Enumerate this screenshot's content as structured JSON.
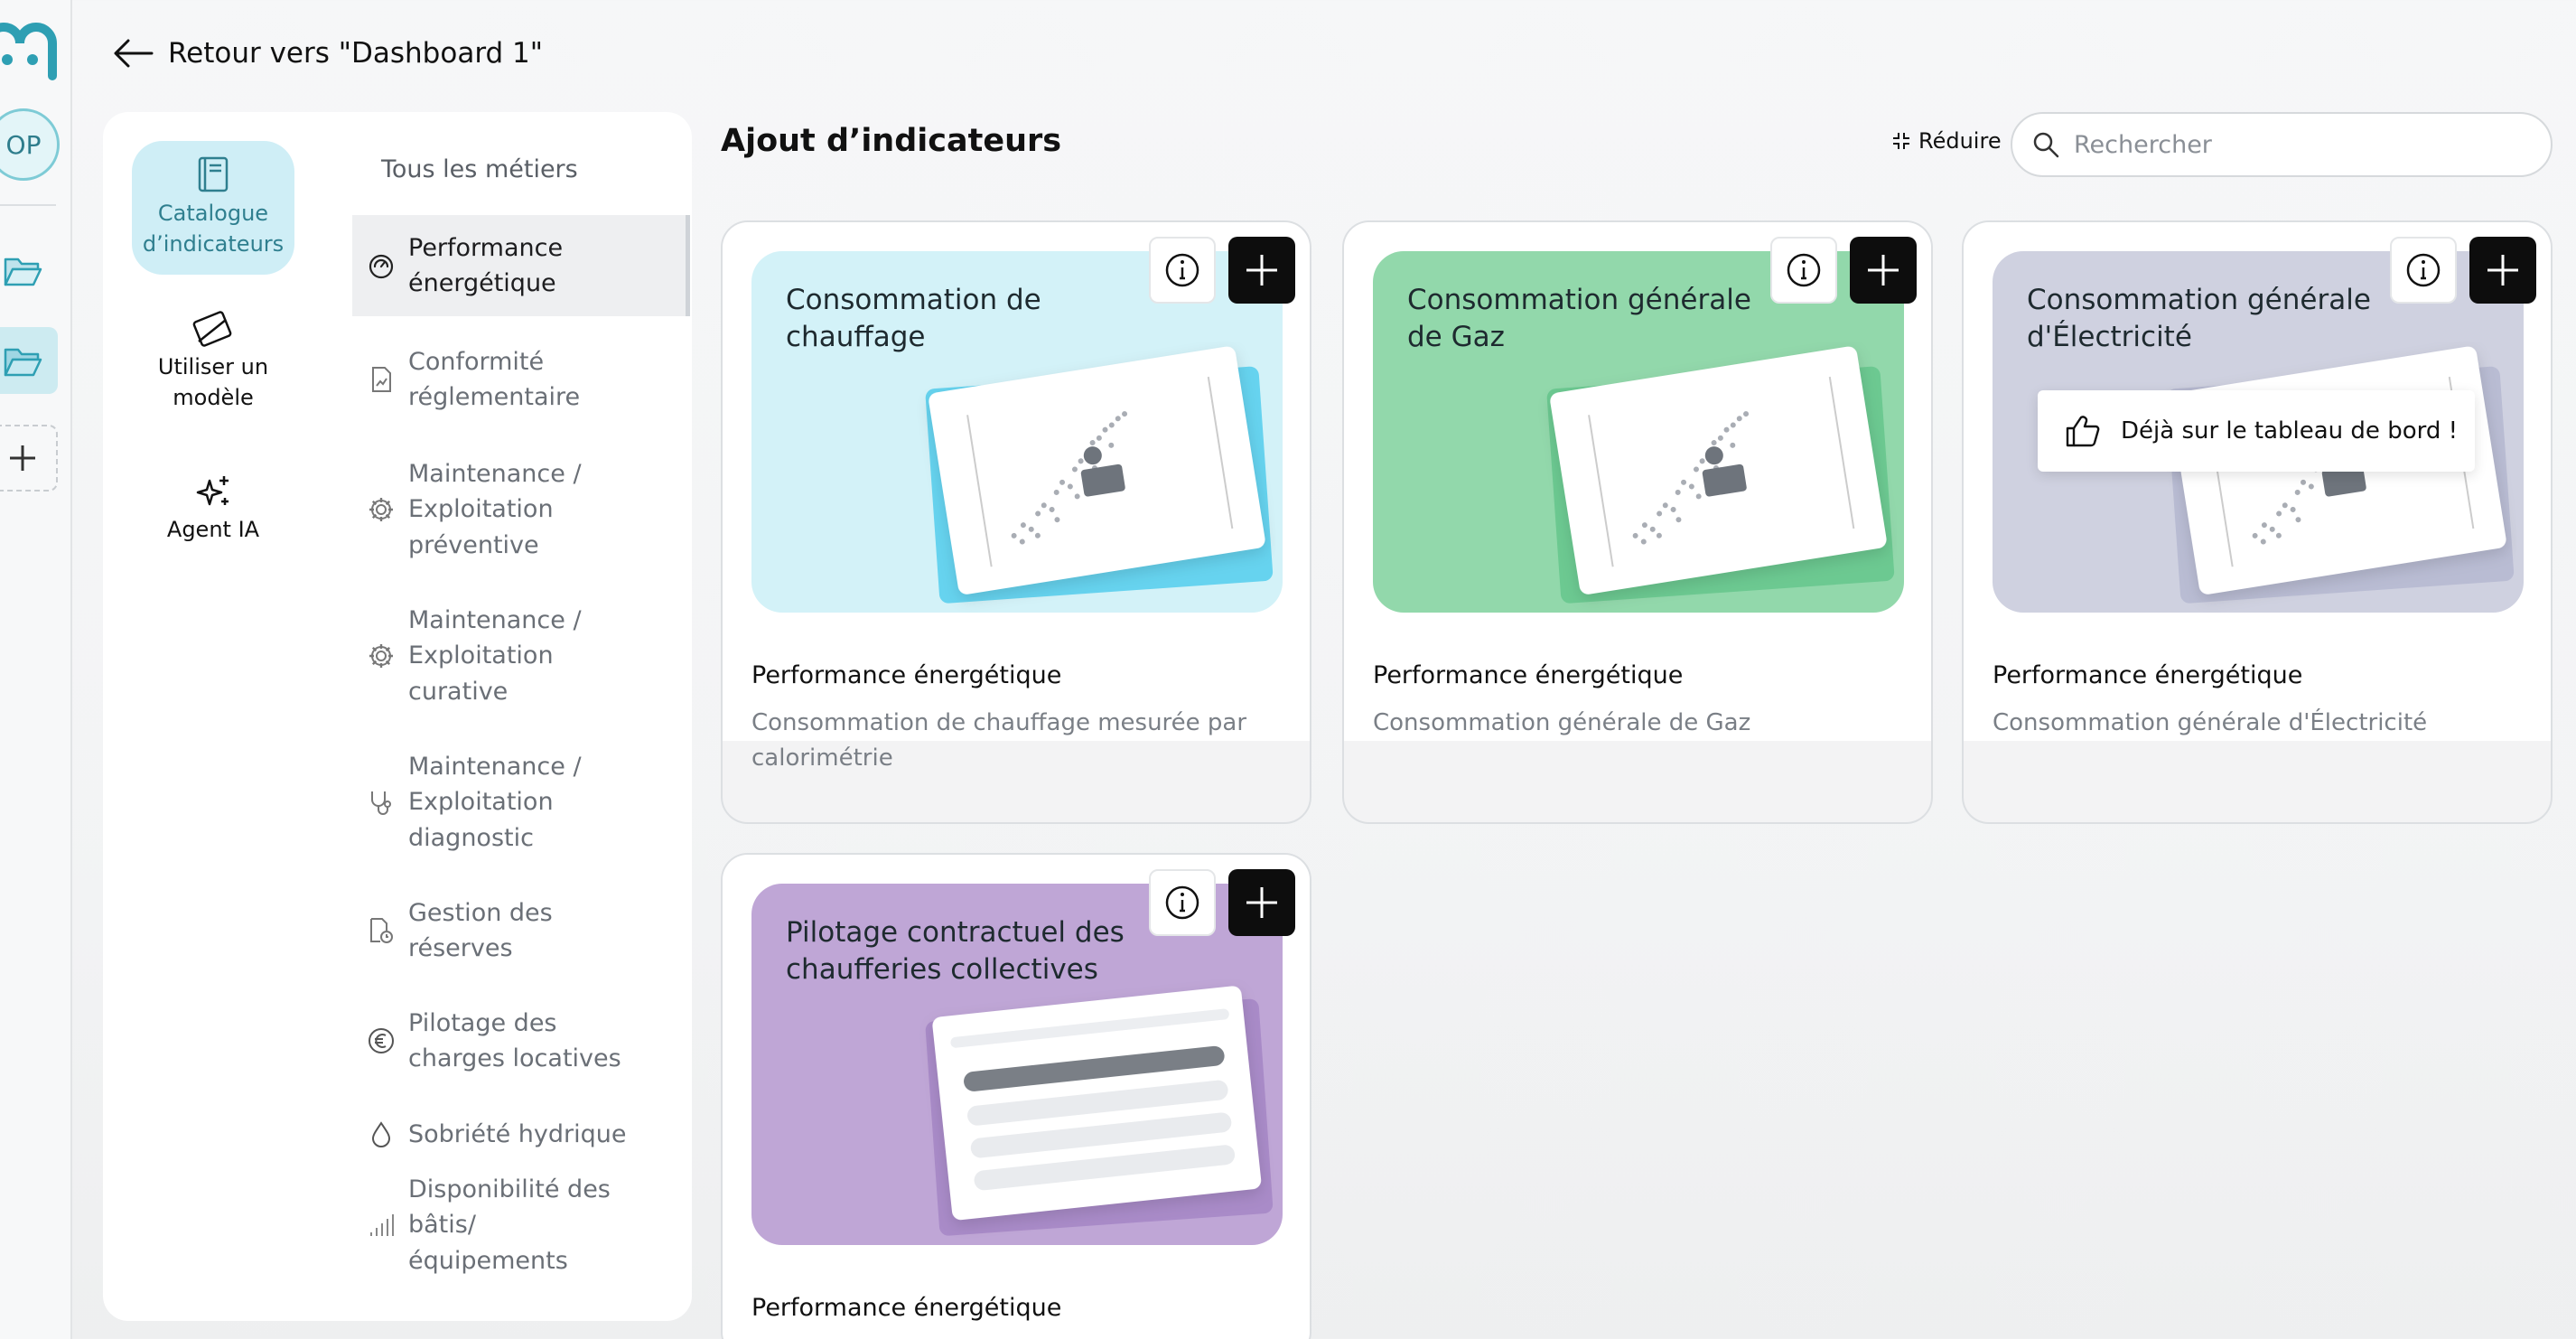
{
  "rail": {
    "avatar": "OP",
    "colors": {
      "accent": "#2e9fb3",
      "active_bg": "#cdebf1"
    }
  },
  "back_link": "Retour vers \"Dashboard 1\"",
  "sidebar": {
    "modes": [
      {
        "label": "Catalogue d’indicateurs",
        "icon": "book-icon",
        "active": true
      },
      {
        "label": "Utiliser un modèle",
        "icon": "template-icon",
        "active": false
      },
      {
        "label": "Agent IA",
        "icon": "sparkles-icon",
        "active": false
      }
    ],
    "categories_header": "Tous les métiers",
    "categories": [
      {
        "label": "Performance énergétique",
        "icon": "energy-icon",
        "active": true
      },
      {
        "label": "Conformité réglementaire",
        "icon": "document-chart-icon",
        "active": false
      },
      {
        "label": "Maintenance / Exploitation préventive",
        "icon": "gear-icon",
        "active": false
      },
      {
        "label": "Maintenance / Exploitation curative",
        "icon": "gear-icon",
        "active": false
      },
      {
        "label": "Maintenance / Exploitation diagnostic",
        "icon": "stethoscope-icon",
        "active": false
      },
      {
        "label": "Gestion des réserves",
        "icon": "document-clock-icon",
        "active": false
      },
      {
        "label": "Pilotage des charges locatives",
        "icon": "euro-icon",
        "active": false
      },
      {
        "label": "Sobriété hydrique",
        "icon": "water-drop-icon",
        "active": false
      },
      {
        "label": "Disponibilité des bâtis/équipements",
        "icon": "signal-bars-icon",
        "active": false
      }
    ]
  },
  "main": {
    "title": "Ajout d’indicateurs",
    "collapse_label": "Réduire",
    "search_placeholder": "Rechercher",
    "already_added_label": "Déjà sur le tableau de bord !",
    "cards": [
      {
        "title": "Consommation de chauffage",
        "category": "Performance énergétique",
        "description": "Consommation de chauffage mesurée par calorimétrie",
        "color": "#d3f2f8",
        "accent": "#66d3ef",
        "kind": "scatter",
        "already_added": false
      },
      {
        "title": "Consommation générale de Gaz",
        "category": "Performance énergétique",
        "description": "Consommation générale de Gaz",
        "color": "#92d8ab",
        "accent": "#6cc991",
        "kind": "scatter",
        "already_added": false
      },
      {
        "title": "Consommation générale d'Électricité",
        "category": "Performance énergétique",
        "description": "Consommation générale d'Électricité",
        "color": "#cfd1e0",
        "accent": "#b9bcd3",
        "kind": "scatter",
        "already_added": true
      },
      {
        "title": "Pilotage contractuel des chaufferies collectives",
        "category": "Performance énergétique",
        "description": "",
        "color": "#bfa6d6",
        "accent": "#a98bc8",
        "kind": "table",
        "already_added": false
      }
    ]
  }
}
